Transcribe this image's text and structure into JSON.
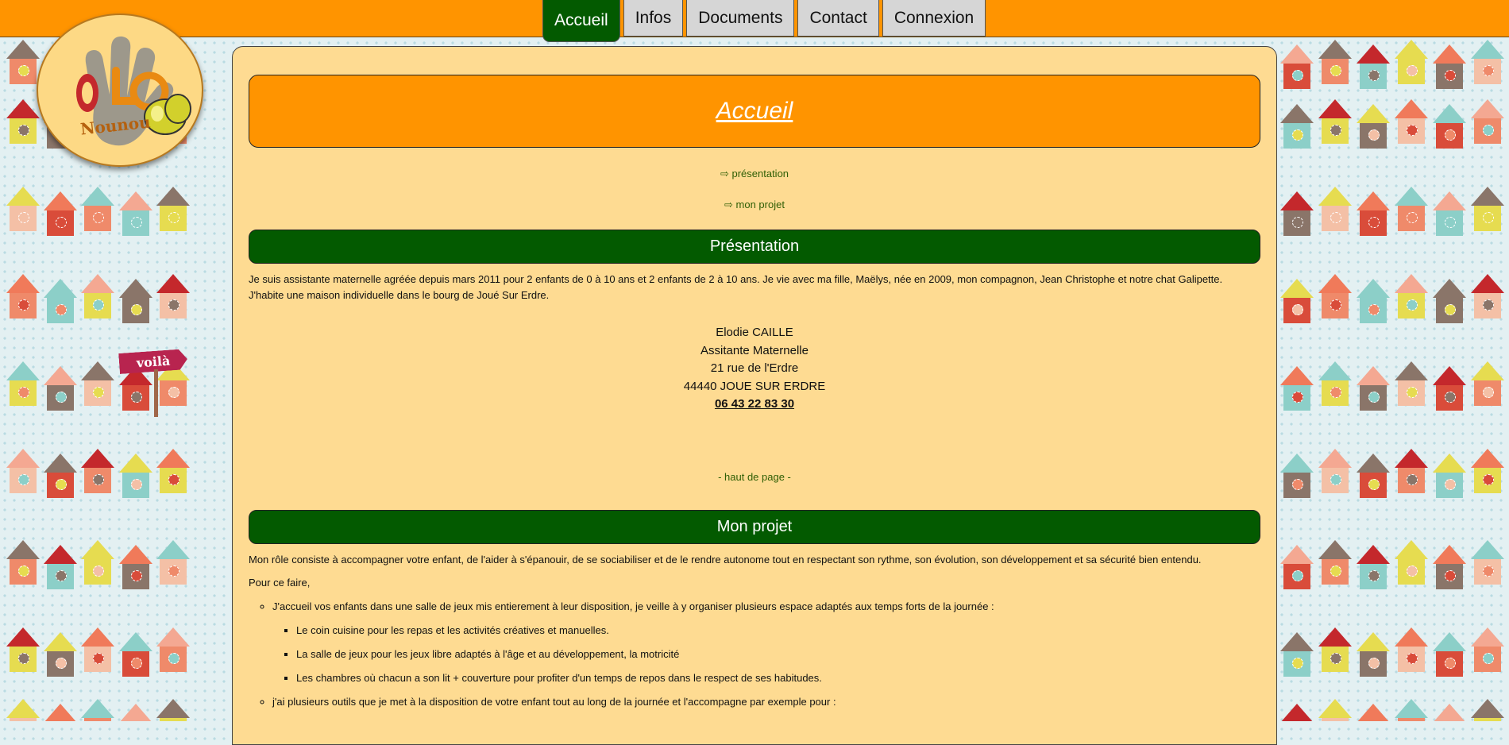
{
  "nav": {
    "tabs": [
      {
        "label": "Accueil",
        "active": true
      },
      {
        "label": "Infos"
      },
      {
        "label": "Documents"
      },
      {
        "label": "Contact"
      },
      {
        "label": "Connexion"
      }
    ]
  },
  "logo": {
    "text": "Nounou",
    "letters": "ELO"
  },
  "sign": {
    "text": "voilà"
  },
  "page": {
    "title": "Accueil",
    "toc": [
      "⇨ présentation",
      "⇨ mon projet"
    ]
  },
  "presentation": {
    "heading": "Présentation",
    "text": "Je suis assistante maternelle agréée depuis mars 2011 pour 2 enfants de 0 à 10 ans et 2 enfants de 2 à 10 ans. Je vie avec ma fille, Maëlys, née en 2009, mon compagnon, Jean Christophe et notre chat Galipette. J'habite une maison individuelle dans le bourg de Joué Sur Erdre.",
    "address": {
      "name": "Elodie CAILLE",
      "role": "Assitante Maternelle",
      "street": "21 rue de l'Erdre",
      "city": "44440 JOUE SUR ERDRE",
      "phone": "06 43 22 83 30"
    },
    "back_to_top": "- haut de page -"
  },
  "projet": {
    "heading": "Mon projet",
    "intro": "Mon rôle consiste à accompagner votre enfant, de l'aider à s'épanouir, de se sociabiliser et de le rendre autonome tout en respectant son rythme, son évolution, son développement et sa sécurité bien entendu.",
    "lead": "Pour ce faire,",
    "items": [
      {
        "text": "J'accueil vos enfants dans une salle de jeux mis entierement à leur disposition, je veille à y organiser plusieurs espace adaptés aux temps forts de la journée :",
        "subitems": [
          "Le coin cuisine pour les repas et les activités créatives et manuelles.",
          "La salle de jeux pour les jeux libre adaptés à l'âge et au développement, la motricité",
          "Les chambres où chacun a son lit + couverture pour profiter d'un temps de repos dans le respect de ses habitudes."
        ]
      },
      {
        "text": "j'ai plusieurs outils que je met à la disposition de votre enfant tout au long de la journée et l'accompagne par exemple pour :"
      }
    ]
  },
  "colors": {
    "accent_orange": "#ff9400",
    "accent_green": "#035a00",
    "panel_bg": "#fedb92",
    "link_green": "#2f5e05"
  }
}
